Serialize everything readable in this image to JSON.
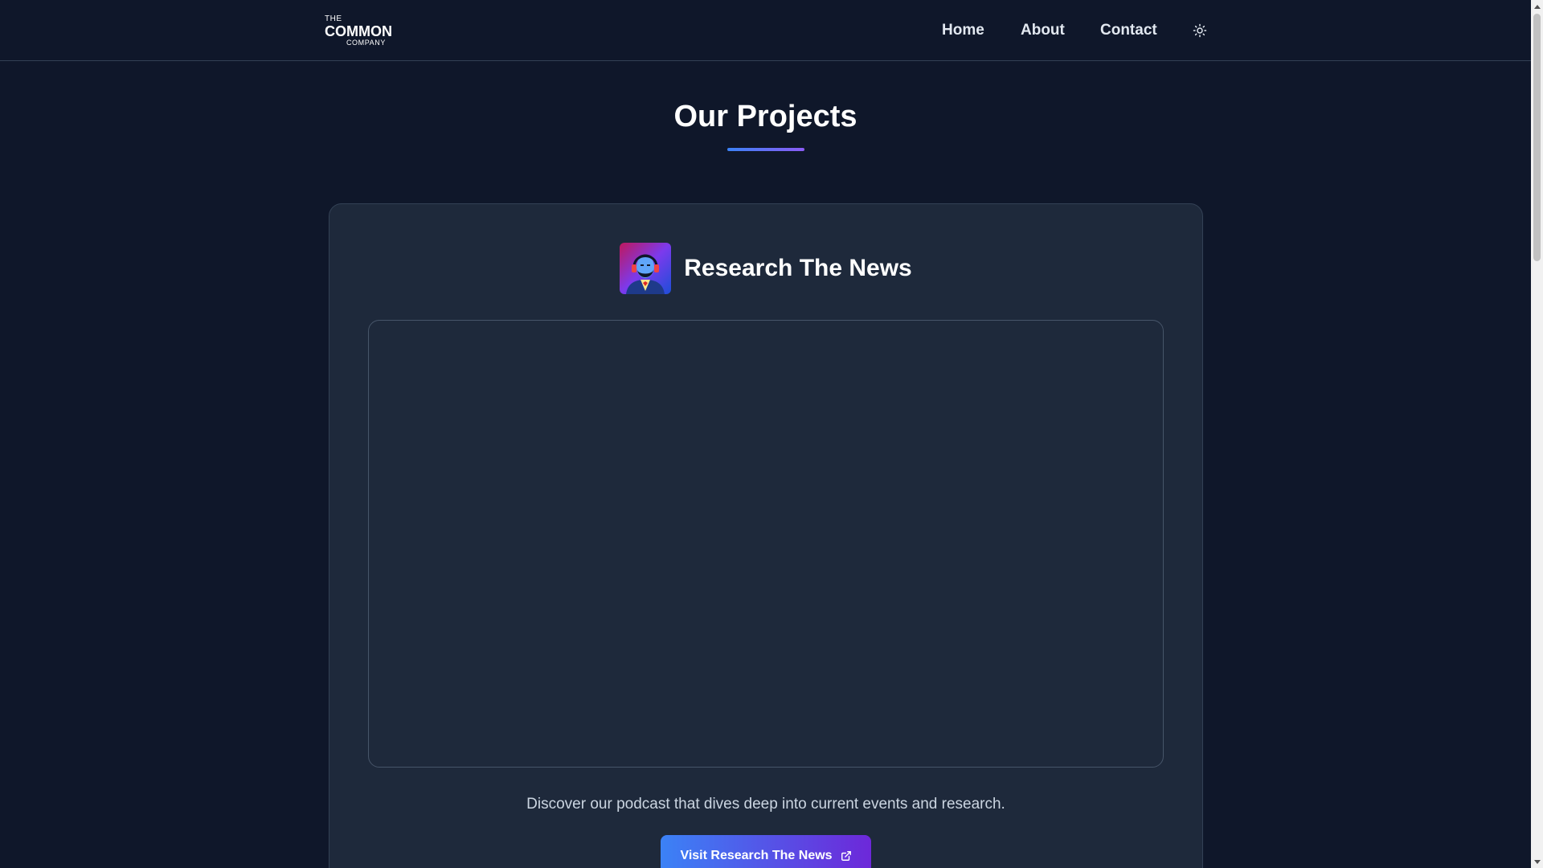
{
  "header": {
    "logo": {
      "line1": "THE",
      "line2": "COMMON",
      "line3": "COMPANY"
    },
    "nav": {
      "home": "Home",
      "about": "About",
      "contact": "Contact"
    },
    "theme_toggle_icon": "sun-icon"
  },
  "main": {
    "section_title": "Our Projects",
    "accent_gradient": [
      "#3b82f6",
      "#8b5cf6"
    ],
    "project": {
      "name": "Research The News",
      "icon": "podcast-avatar-icon",
      "description": "Discover our podcast that dives deep into current events and research.",
      "button_label": "Visit Research The News",
      "button_icon": "external-link-icon"
    }
  },
  "colors": {
    "background": "#0f172a",
    "card": "#1e293b",
    "border": "#334155"
  }
}
